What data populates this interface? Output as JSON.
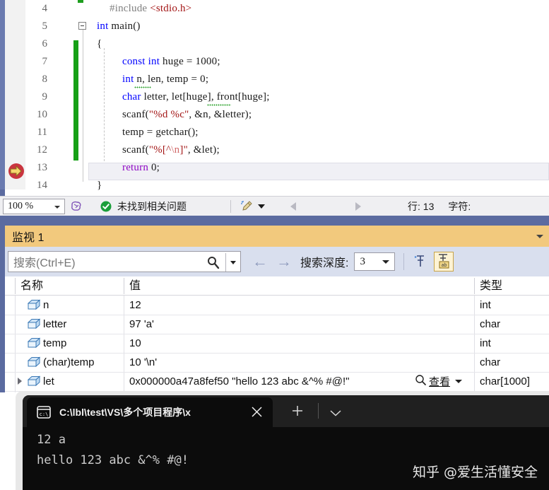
{
  "editor": {
    "lines": [
      {
        "no": "4",
        "indent": 36,
        "tokens": [
          {
            "t": "#include ",
            "c": "pp"
          },
          {
            "t": "<stdio.h>",
            "c": "str"
          }
        ]
      },
      {
        "no": "5",
        "indent": 18,
        "tokens": [
          {
            "t": "int",
            "c": "kw"
          },
          {
            "t": " main",
            "c": "plain"
          },
          {
            "t": "()",
            "c": "plain"
          }
        ]
      },
      {
        "no": "6",
        "indent": 18,
        "tokens": [
          {
            "t": "{",
            "c": "plain"
          }
        ]
      },
      {
        "no": "7",
        "indent": 54,
        "tokens": [
          {
            "t": "const",
            "c": "kw"
          },
          {
            "t": " ",
            "c": "plain"
          },
          {
            "t": "int",
            "c": "kw"
          },
          {
            "t": " huge = ",
            "c": "plain"
          },
          {
            "t": "1000",
            "c": "num"
          },
          {
            "t": ";",
            "c": "plain"
          }
        ]
      },
      {
        "no": "8",
        "indent": 54,
        "tokens": [
          {
            "t": "int",
            "c": "kw"
          },
          {
            "t": " n, len, temp = ",
            "c": "plain"
          },
          {
            "t": "0",
            "c": "num"
          },
          {
            "t": ";",
            "c": "plain"
          }
        ]
      },
      {
        "no": "9",
        "indent": 54,
        "tokens": [
          {
            "t": "char",
            "c": "kw"
          },
          {
            "t": " letter, let[huge], front[huge];",
            "c": "plain"
          }
        ]
      },
      {
        "no": "10",
        "indent": 54,
        "tokens": [
          {
            "t": "scanf(",
            "c": "plain"
          },
          {
            "t": "\"%d %c\"",
            "c": "str"
          },
          {
            "t": ", &n, &letter);",
            "c": "plain"
          }
        ]
      },
      {
        "no": "11",
        "indent": 54,
        "tokens": [
          {
            "t": "temp = getchar();",
            "c": "plain"
          }
        ]
      },
      {
        "no": "12",
        "indent": 54,
        "tokens": [
          {
            "t": "scanf(",
            "c": "plain"
          },
          {
            "t": "\"%[^",
            "c": "str"
          },
          {
            "t": "\\n",
            "c": "esc"
          },
          {
            "t": "]\"",
            "c": "str"
          },
          {
            "t": ", &let);",
            "c": "plain"
          }
        ]
      },
      {
        "no": "13",
        "indent": 54,
        "tokens": [
          {
            "t": "return",
            "c": "ctl"
          },
          {
            "t": " ",
            "c": "plain"
          },
          {
            "t": "0",
            "c": "num"
          },
          {
            "t": ";",
            "c": "plain"
          }
        ]
      },
      {
        "no": "14",
        "indent": 18,
        "tokens": [
          {
            "t": "}",
            "c": "plain"
          }
        ]
      }
    ]
  },
  "statusbar": {
    "zoom": "100 %",
    "intellisense_icon": "brain-icon",
    "status_ok_icon": "check-circle-icon",
    "status_text": "未找到相关问题",
    "broom_icon": "broom-icon",
    "line_label": "行: 13",
    "char_label": "字符:"
  },
  "watch": {
    "title": "监视 1",
    "search_placeholder": "搜索(Ctrl+E)",
    "search_icon": "search-icon",
    "back_arrow": "←",
    "forward_arrow": "→",
    "depth_label": "搜索深度:",
    "depth_value": "3",
    "pin_icon": "pin-icon",
    "hex_icon": "hex-display-icon",
    "columns": [
      "名称",
      "值",
      "类型"
    ],
    "rows": [
      {
        "name": "n",
        "value": "12",
        "type": "int",
        "expandable": false,
        "has_view": false
      },
      {
        "name": "letter",
        "value": "97 'a'",
        "type": "char",
        "expandable": false,
        "has_view": false
      },
      {
        "name": "temp",
        "value": "10",
        "type": "int",
        "expandable": false,
        "has_view": false
      },
      {
        "name": "(char)temp",
        "value": "10 '\\n'",
        "type": "char",
        "expandable": false,
        "has_view": false
      },
      {
        "name": "let",
        "value": "0x000000a47a8fef50 \"hello 123 abc &^% #@!\"",
        "type": "char[1000]",
        "expandable": true,
        "has_view": true
      }
    ],
    "view_button_label": "查看"
  },
  "console": {
    "tab_icon": "cmd-icon",
    "tab_title": "C:\\lbl\\test\\VS\\多个项目程序\\x",
    "close_icon": "close-icon",
    "new_tab_icon": "plus-icon",
    "dropdown_icon": "chevron-down-icon",
    "output_lines": [
      "12 a",
      "hello 123 abc &^% #@!"
    ],
    "watermark": "知乎 @爱生活懂安全"
  },
  "colors": {
    "accent_blue": "#5b6ba0",
    "watch_title_bg": "#f2c97d",
    "toolbar_bg": "#d9dfee",
    "keyword": "#0000ff",
    "string": "#a31515",
    "control": "#8f08c4",
    "changebar_green": "#16a016",
    "console_bg": "#0c0c0c"
  }
}
